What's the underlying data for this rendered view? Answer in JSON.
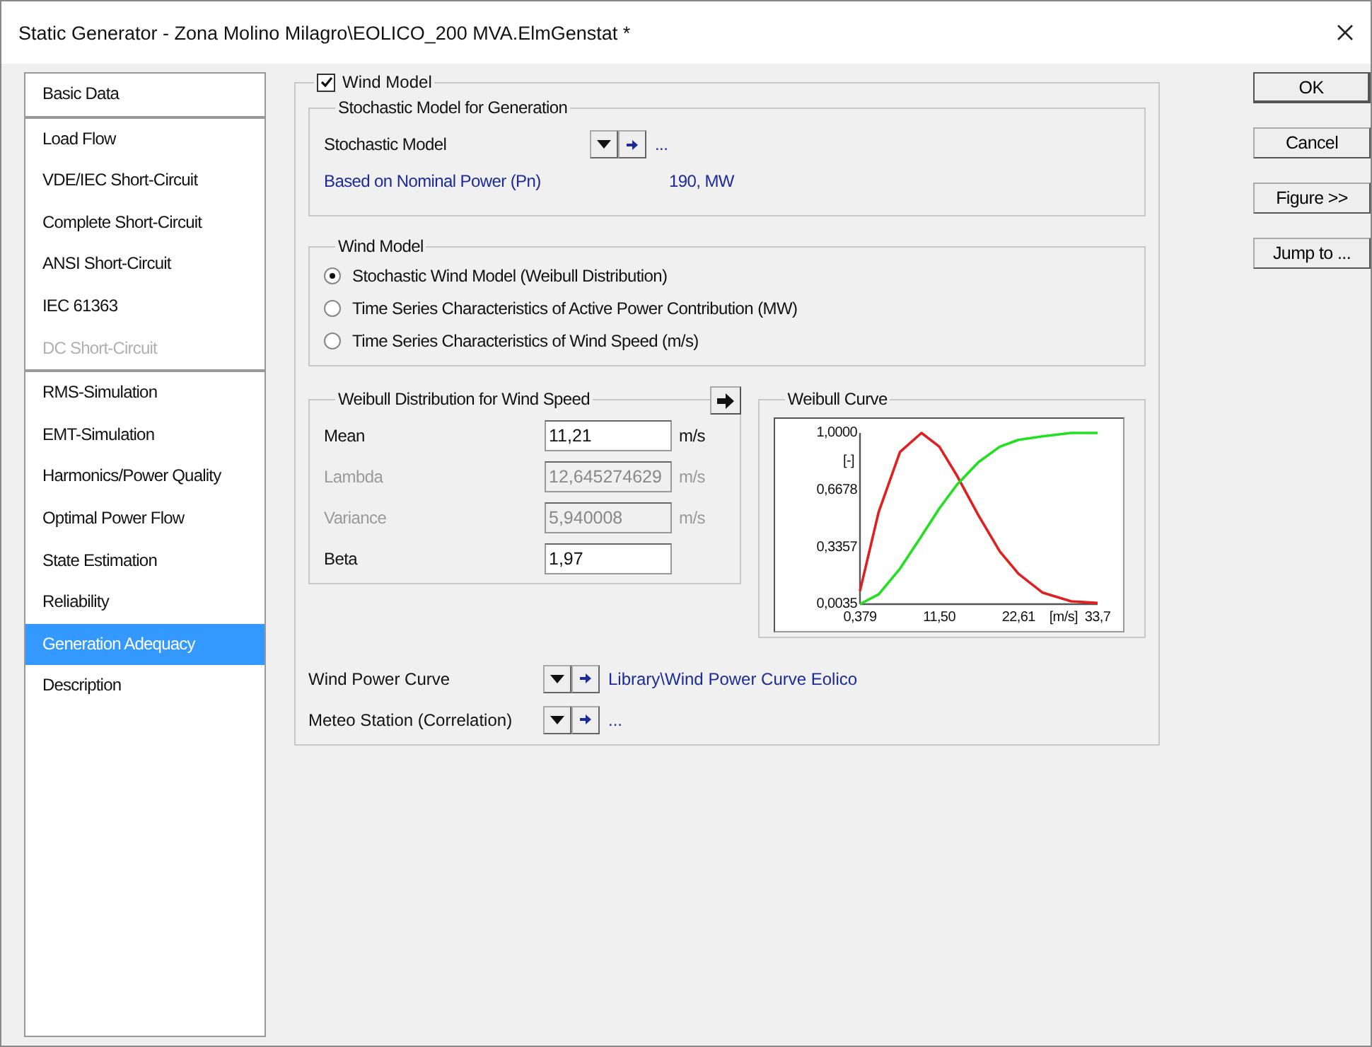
{
  "window": {
    "title": "Static Generator - Zona Molino Milagro\\EOLICO_200 MVA.ElmGenstat *"
  },
  "sidebar": {
    "sections": [
      {
        "items": [
          {
            "label": "Basic Data",
            "selected": false,
            "disabled": false
          }
        ]
      },
      {
        "items": [
          {
            "label": "Load Flow",
            "selected": false,
            "disabled": false
          },
          {
            "label": "VDE/IEC Short-Circuit",
            "selected": false,
            "disabled": false
          },
          {
            "label": "Complete Short-Circuit",
            "selected": false,
            "disabled": false
          },
          {
            "label": "ANSI Short-Circuit",
            "selected": false,
            "disabled": false
          },
          {
            "label": "IEC 61363",
            "selected": false,
            "disabled": false
          },
          {
            "label": "DC Short-Circuit",
            "selected": false,
            "disabled": true
          }
        ]
      },
      {
        "items": [
          {
            "label": "RMS-Simulation",
            "selected": false,
            "disabled": false
          },
          {
            "label": "EMT-Simulation",
            "selected": false,
            "disabled": false
          },
          {
            "label": "Harmonics/Power Quality",
            "selected": false,
            "disabled": false
          },
          {
            "label": "Optimal Power Flow",
            "selected": false,
            "disabled": false
          },
          {
            "label": "State Estimation",
            "selected": false,
            "disabled": false
          },
          {
            "label": "Reliability",
            "selected": false,
            "disabled": false
          },
          {
            "label": "Generation Adequacy",
            "selected": true,
            "disabled": false
          },
          {
            "label": "Description",
            "selected": false,
            "disabled": false
          }
        ]
      }
    ]
  },
  "wind_model_toggle": {
    "label": "Wind Model",
    "checked": true
  },
  "stochastic_group": {
    "title": "Stochastic Model for Generation",
    "model": {
      "label": "Stochastic Model",
      "value": "..."
    },
    "based_on": {
      "label": "Based on Nominal Power (Pn)",
      "value": "190, MW"
    }
  },
  "wind_model_group": {
    "title": "Wind Model",
    "options": [
      {
        "label": "Stochastic Wind Model (Weibull Distribution)",
        "selected": true
      },
      {
        "label": "Time Series Characteristics of Active Power Contribution (MW)",
        "selected": false
      },
      {
        "label": "Time Series Characteristics of Wind Speed (m/s)",
        "selected": false
      }
    ]
  },
  "weibull_group": {
    "title": "Weibull Distribution for Wind Speed",
    "fields": [
      {
        "label": "Mean",
        "value": "11,21",
        "unit": "m/s",
        "disabled": false
      },
      {
        "label": "Lambda",
        "value": "12,645274629",
        "unit": "m/s",
        "disabled": true
      },
      {
        "label": "Variance",
        "value": "5,940008",
        "unit": "m/s",
        "disabled": true
      },
      {
        "label": "Beta",
        "value": "1,97",
        "disabled": false
      }
    ]
  },
  "weibull_curve": {
    "title": "Weibull Curve",
    "chart_data": {
      "type": "line",
      "ylabel": "[-]",
      "xlabel": "[m/s]",
      "x": [
        0.379,
        3,
        6,
        9,
        11.5,
        14,
        17,
        20,
        22.61,
        26,
        30,
        33.7
      ],
      "series": [
        {
          "color": "#e02020",
          "values": [
            0.08,
            0.54,
            0.89,
            1.0,
            0.92,
            0.75,
            0.52,
            0.31,
            0.18,
            0.07,
            0.02,
            0.01
          ]
        },
        {
          "color": "#20e020",
          "values": [
            0.0035,
            0.06,
            0.21,
            0.4,
            0.56,
            0.7,
            0.83,
            0.92,
            0.96,
            0.98,
            1.0,
            1.0
          ]
        }
      ],
      "xlim": [
        0.379,
        33.7
      ],
      "ylim": [
        0.0035,
        1.0
      ],
      "xticks": [
        {
          "value": 0.379,
          "label": "0,379"
        },
        {
          "value": 11.5,
          "label": "11,50"
        },
        {
          "value": 22.61,
          "label": "22,61"
        },
        {
          "value": 33.7,
          "label": "33,7"
        }
      ],
      "yticks": [
        {
          "value": 0.0035,
          "label": "0,0035"
        },
        {
          "value": 0.3357,
          "label": "0,3357"
        },
        {
          "value": 0.6678,
          "label": "0,6678"
        },
        {
          "value": 1.0,
          "label": "1,0000"
        }
      ]
    }
  },
  "references": [
    {
      "label": "Wind Power Curve",
      "value": "Library\\Wind Power Curve Eolico"
    },
    {
      "label": "Meteo Station (Correlation)",
      "value": "..."
    }
  ],
  "buttons": [
    {
      "label": "OK",
      "default": true
    },
    {
      "label": "Cancel",
      "default": false
    },
    {
      "label": "Figure >>",
      "default": false
    },
    {
      "label": "Jump to ...",
      "default": false
    }
  ]
}
